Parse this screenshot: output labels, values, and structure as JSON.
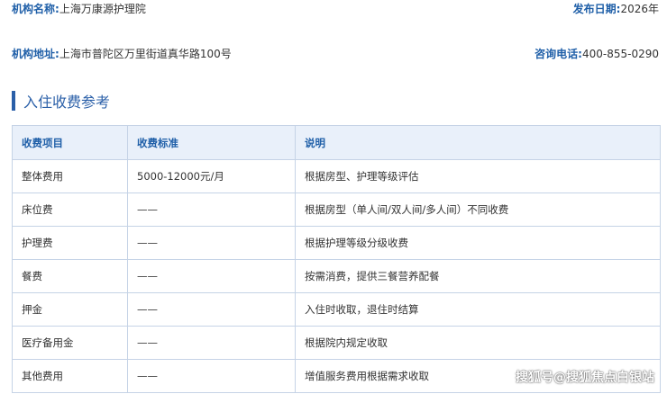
{
  "header": {
    "org_name_label": "机构名称:",
    "org_name": "上海万康源护理院",
    "publish_label": "发布日期:",
    "publish_date": "2026年",
    "address_label": "机构地址:",
    "address": "上海市普陀区万里街道真华路100号",
    "phone_label": "咨询电话:",
    "phone": "400-855-0290"
  },
  "section": {
    "title": "入住收费参考"
  },
  "table": {
    "headers": [
      "收费项目",
      "收费标准",
      "说明"
    ],
    "rows": [
      [
        "整体费用",
        "5000-12000元/月",
        "根据房型、护理等级评估"
      ],
      [
        "床位费",
        "——",
        "根据房型（单人间/双人间/多人间）不同收费"
      ],
      [
        "护理费",
        "——",
        "根据护理等级分级收费"
      ],
      [
        "餐费",
        "——",
        "按需消费，提供三餐营养配餐"
      ],
      [
        "押金",
        "——",
        "入住时收取，退住时结算"
      ],
      [
        "医疗备用金",
        "——",
        "根据院内规定收取"
      ],
      [
        "其他费用",
        "——",
        "增值服务费用根据需求收取"
      ]
    ]
  },
  "watermark": "搜狐号@搜狐焦点白银站",
  "colors": {
    "accent": "#1f5fa8",
    "header_bg": "#e9f0fa",
    "border": "#c5d3e6"
  }
}
